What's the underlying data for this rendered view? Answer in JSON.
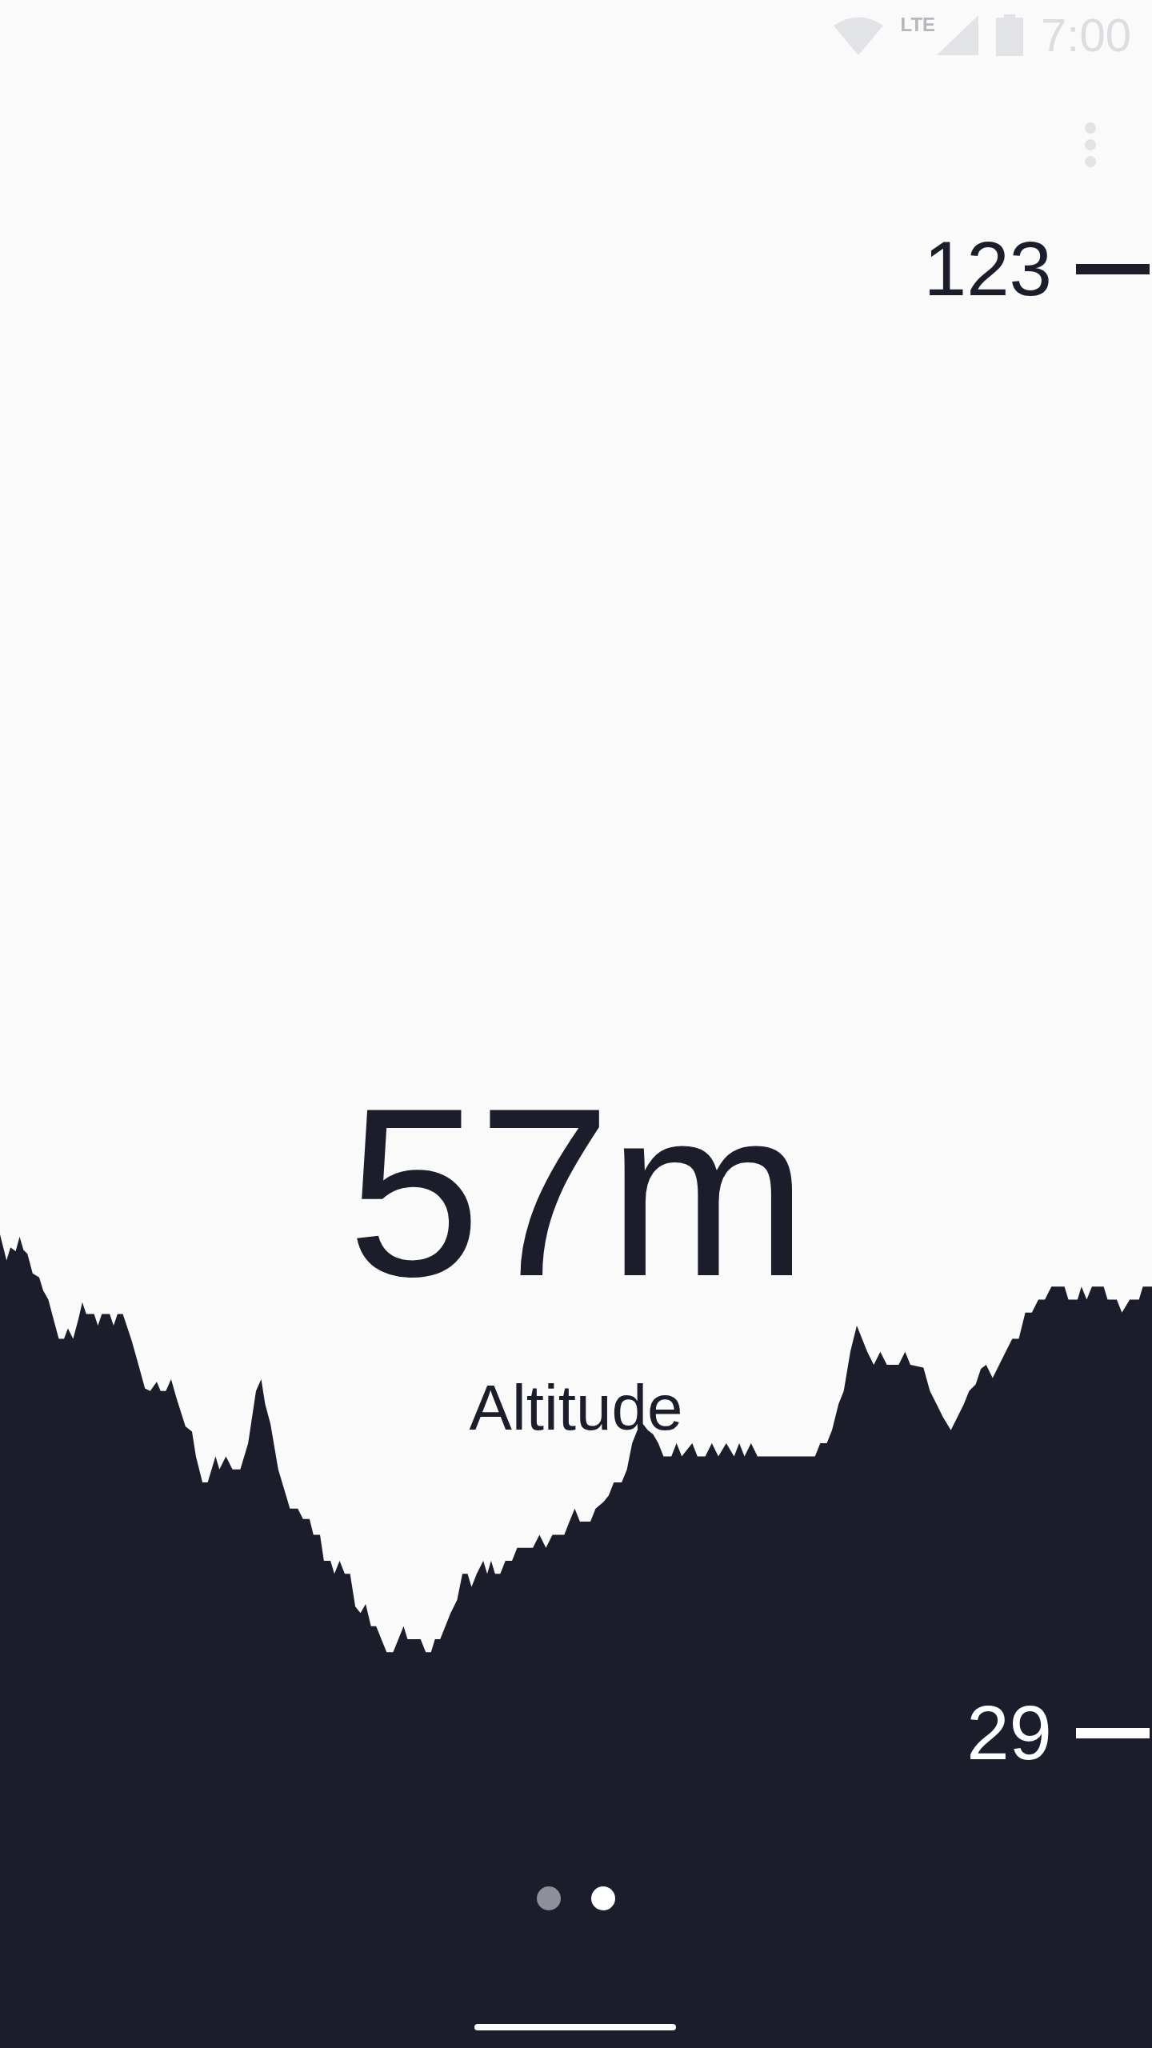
{
  "status_bar": {
    "network": "LTE",
    "time": "7:00"
  },
  "scale_marks": [
    {
      "label": "123"
    },
    {
      "label": "29"
    }
  ],
  "reading": {
    "value": "57m",
    "label": "Altitude"
  },
  "pages": [
    {
      "selected": false
    },
    {
      "selected": true
    }
  ]
}
